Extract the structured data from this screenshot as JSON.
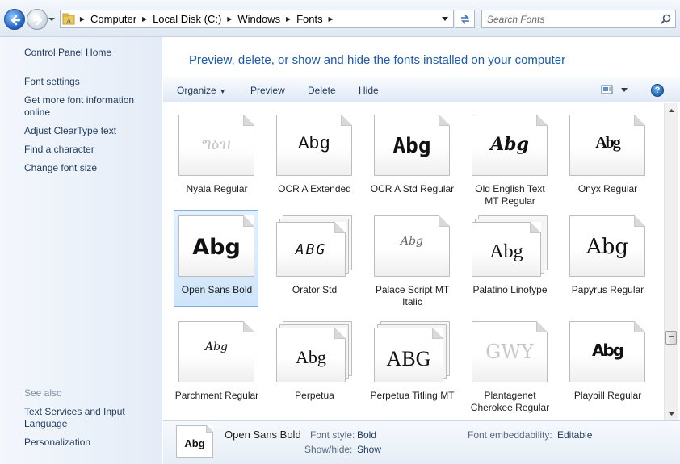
{
  "address": {
    "breadcrumbs": [
      "Computer",
      "Local Disk (C:)",
      "Windows",
      "Fonts"
    ],
    "search_placeholder": "Search Fonts"
  },
  "sidebar": {
    "links": [
      "Control Panel Home",
      "Font settings",
      "Get more font information online",
      "Adjust ClearType text",
      "Find a character",
      "Change font size"
    ],
    "see_also_heading": "See also",
    "see_also_links": [
      "Text Services and Input Language",
      "Personalization"
    ]
  },
  "header": {
    "title": "Preview, delete, or show and hide the fonts installed on your computer"
  },
  "toolbar": {
    "organize": "Organize",
    "preview": "Preview",
    "delete": "Delete",
    "hide": "Hide"
  },
  "fonts": [
    {
      "label": "Nyala Regular",
      "sample": "ግዕዝ",
      "stack": false,
      "dim": true
    },
    {
      "label": "OCR A Extended",
      "sample": "Abg",
      "stack": false,
      "dim": false
    },
    {
      "label": "OCR A Std Regular",
      "sample": "Abg",
      "stack": false,
      "dim": false
    },
    {
      "label": "Old English Text MT Regular",
      "sample": "Abg",
      "stack": false,
      "dim": false
    },
    {
      "label": "Onyx Regular",
      "sample": "Abg",
      "stack": false,
      "dim": false
    },
    {
      "label": "Open Sans Bold",
      "sample": "Abg",
      "stack": false,
      "dim": false,
      "selected": true
    },
    {
      "label": "Orator Std",
      "sample": "ABG",
      "stack": true,
      "dim": false
    },
    {
      "label": "Palace Script MT Italic",
      "sample": "Abg",
      "stack": false,
      "dim": false
    },
    {
      "label": "Palatino Linotype",
      "sample": "Abg",
      "stack": true,
      "dim": false
    },
    {
      "label": "Papyrus Regular",
      "sample": "Abg",
      "stack": false,
      "dim": false
    },
    {
      "label": "Parchment Regular",
      "sample": "Abg",
      "stack": false,
      "dim": false
    },
    {
      "label": "Perpetua",
      "sample": "Abg",
      "stack": true,
      "dim": false
    },
    {
      "label": "Perpetua Titling MT",
      "sample": "ABG",
      "stack": true,
      "dim": false
    },
    {
      "label": "Plantagenet Cherokee Regular",
      "sample": "GWY",
      "stack": false,
      "dim": true
    },
    {
      "label": "Playbill Regular",
      "sample": "Abg",
      "stack": false,
      "dim": false
    }
  ],
  "details": {
    "thumb_sample": "Abg",
    "name": "Open Sans Bold",
    "font_style_label": "Font style:",
    "font_style_value": "Bold",
    "show_hide_label": "Show/hide:",
    "show_hide_value": "Show",
    "embed_label": "Font embeddability:",
    "embed_value": "Editable"
  },
  "colors": {
    "link": "#1e395b",
    "title": "#1e5aa5",
    "selection": "#cfe5fa"
  }
}
